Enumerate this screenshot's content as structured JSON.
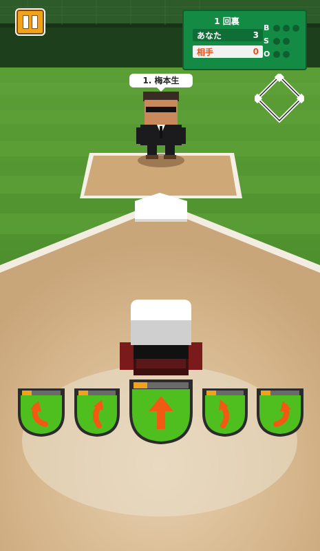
{
  "scoreboard": {
    "inning": "1 回裏",
    "teams": [
      {
        "name": "あなた",
        "score": "3"
      },
      {
        "name": "相手",
        "score": "0"
      }
    ],
    "bso_labels": [
      "B",
      "S",
      "O"
    ],
    "counts": {
      "balls": 0,
      "strikes": 0,
      "outs": 0
    }
  },
  "batter_name": "1. 梅本生",
  "swing_buttons": [
    {
      "icon": "curve-left-arrow-icon",
      "power_level": 0.25
    },
    {
      "icon": "sharp-curve-left-arrow-icon",
      "power_level": 0.25
    },
    {
      "icon": "straight-up-arrow-icon",
      "power_level": 0.25
    },
    {
      "icon": "sharp-curve-right-arrow-icon",
      "power_level": 0.25
    },
    {
      "icon": "curve-right-arrow-icon",
      "power_level": 0.25
    }
  ],
  "colors": {
    "accent_orange": "#f0a21a",
    "scoreboard_green": "#148b45",
    "button_green": "#4fbf1f",
    "arrow_orange": "#f25a12"
  }
}
